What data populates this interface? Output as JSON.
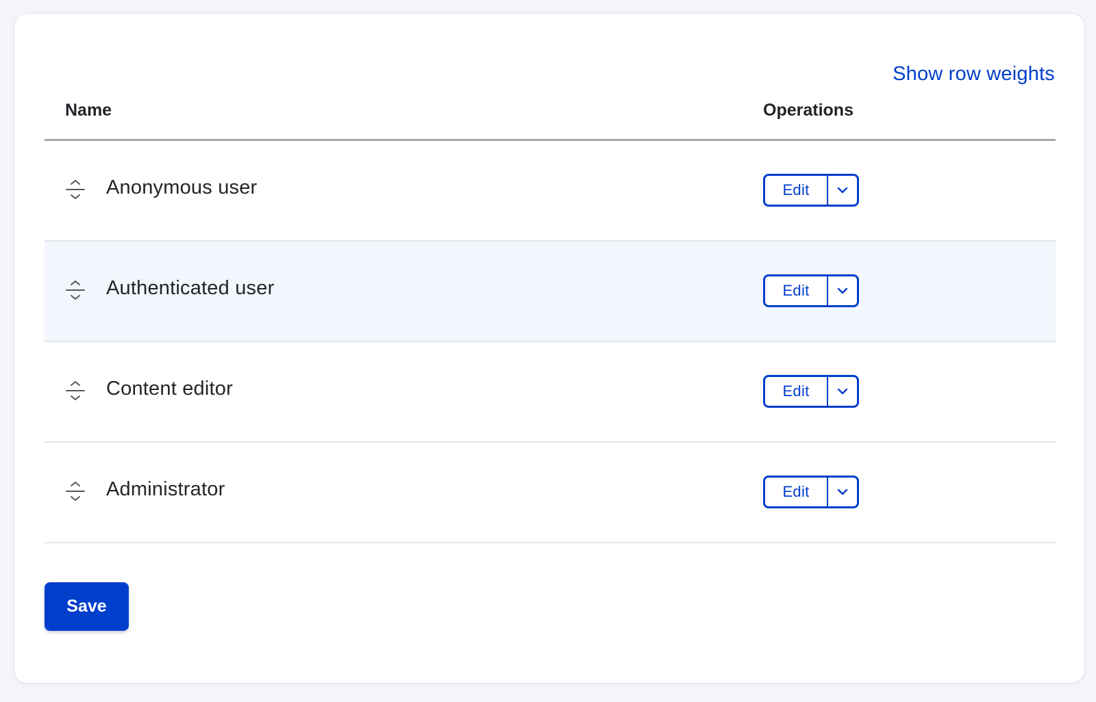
{
  "links": {
    "show_row_weights": "Show row weights"
  },
  "table": {
    "headers": {
      "name": "Name",
      "operations": "Operations"
    },
    "rows": [
      {
        "name": "Anonymous user",
        "edit_label": "Edit"
      },
      {
        "name": "Authenticated user",
        "edit_label": "Edit"
      },
      {
        "name": "Content editor",
        "edit_label": "Edit"
      },
      {
        "name": "Administrator",
        "edit_label": "Edit"
      }
    ]
  },
  "actions": {
    "save_label": "Save"
  },
  "icons": {
    "drag": "drag-handle-icon",
    "dropdown": "chevron-down-icon"
  },
  "colors": {
    "accent": "#003ecc",
    "row_highlight": "#f2f6fd",
    "page_background": "#f3f5fa"
  }
}
